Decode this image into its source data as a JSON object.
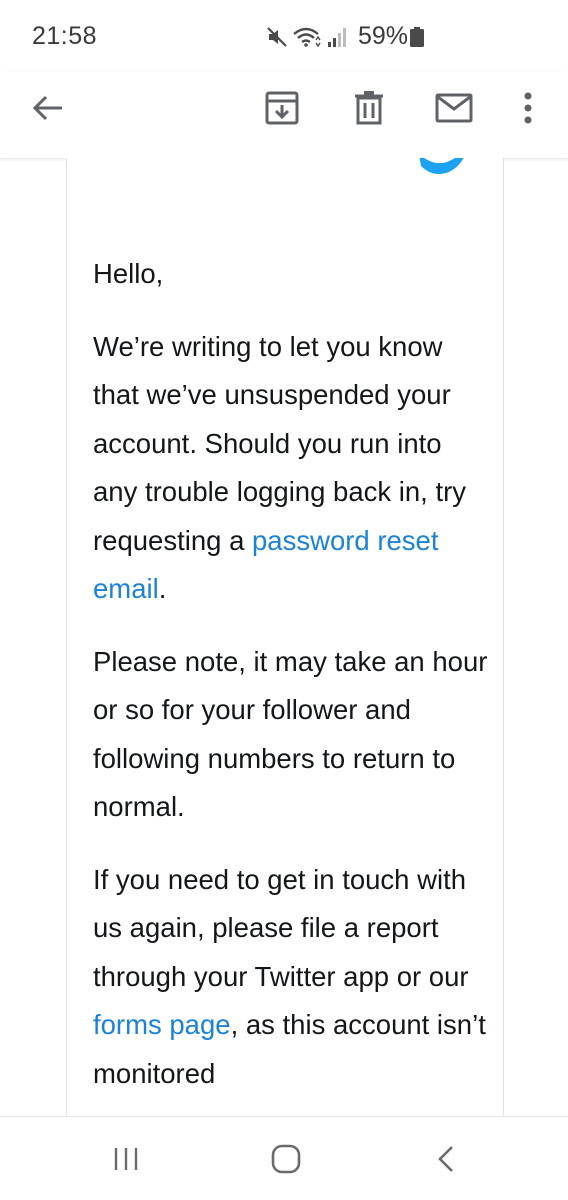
{
  "status_bar": {
    "time": "21:58",
    "battery_text": "59%",
    "icons": [
      "mute-icon",
      "wifi-icon",
      "signal-icon",
      "battery-icon"
    ]
  },
  "toolbar": {
    "back_icon": "arrow-left-icon",
    "archive_icon": "archive-icon",
    "delete_icon": "trash-icon",
    "mark_unread_icon": "mail-icon",
    "more_icon": "more-vert-icon"
  },
  "email": {
    "brand_color": "#1da1f2",
    "link_color": "#1b82d9",
    "greeting": "Hello,",
    "para1_text": "We’re writing to let you know that we’ve unsuspended your account. Should you run into any trouble logging back in, try requesting a ",
    "para1_link": "password reset email",
    "para1_end": ".",
    "para2": "Please note, it may take an hour or so for your follower and following numbers to return to normal.",
    "para3_text": "If you need to get in touch with us again, please file a report through your Twitter app or our ",
    "para3_link": "forms page",
    "para3_end": ", as this account isn’t monitored"
  },
  "nav_bar": {
    "recents_icon": "recents-icon",
    "home_icon": "home-icon",
    "back_icon": "back-chevron-icon"
  }
}
